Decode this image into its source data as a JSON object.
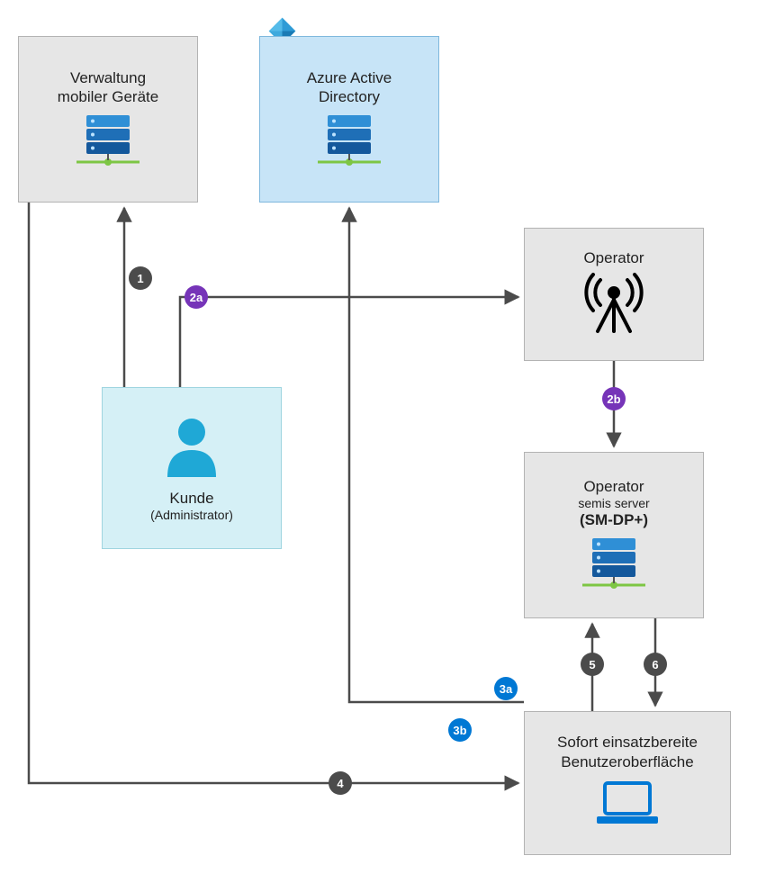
{
  "nodes": {
    "mdm": {
      "title": "Verwaltung",
      "subtitle": "mobiler Geräte"
    },
    "aad": {
      "title": "Azure Active",
      "subtitle": "Directory"
    },
    "operator": {
      "title": "Operator"
    },
    "server": {
      "title": "Operator",
      "sub1": "semis server",
      "sub2": "(SM-DP+)"
    },
    "oobe": {
      "line1": "Sofort einsatzbereite",
      "line2": "Benutzeroberfläche"
    },
    "kunde": {
      "title": "Kunde",
      "subtitle": "(Administrator)"
    }
  },
  "steps": {
    "s1": "1",
    "s2a": "2a",
    "s2b": "2b",
    "s3a": "3a",
    "s3b": "3b",
    "s4": "4",
    "s5": "5",
    "s6": "6"
  },
  "colors": {
    "badge_dark": "#4b4b4b",
    "badge_purple": "#7634b8",
    "badge_blue": "#0078d4",
    "aad_bg": "#c7e4f7",
    "kunde_bg": "#d5f0f6",
    "node_bg": "#e6e6e6"
  }
}
